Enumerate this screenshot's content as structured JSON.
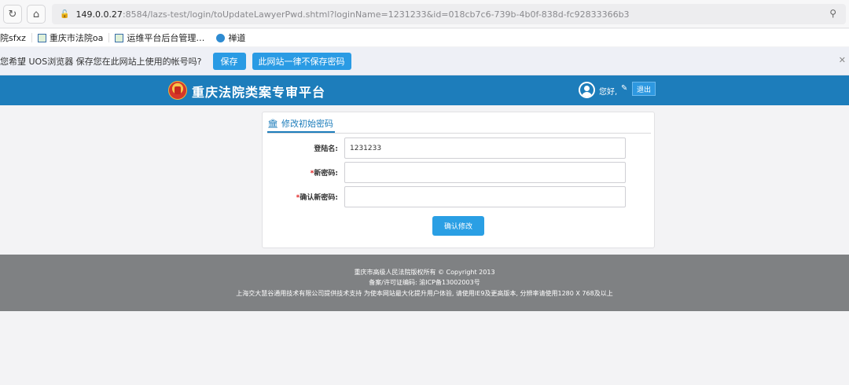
{
  "browser": {
    "url_host": "149.0.0.27",
    "url_rest": ":8584/lazs-test/login/toUpdateLawyerPwd.shtml?loginName=1231233&id=018cb7c6-739b-4b0f-838d-fc92833366b3",
    "bookmarks": [
      "院sfxz",
      "重庆市法院oa",
      "运维平台后台管理…",
      "禅道"
    ],
    "password_prompt": "您希望 UOS浏览器 保存您在此网站上使用的帐号吗?",
    "save_label": "保存",
    "never_save_label": "此网站一律不保存密码"
  },
  "header": {
    "title": "重庆法院类案专审平台",
    "greeting": "您好,",
    "logout_label": "退出"
  },
  "form": {
    "tab_title": "修改初始密码",
    "login_name_label": "登陆名:",
    "login_name_value": "1231233",
    "new_pwd_label": "新密码:",
    "confirm_pwd_label": "确认新密码:",
    "required_mark": "*",
    "submit_label": "确认修改"
  },
  "footer": {
    "line1": "重庆市高级人民法院版权所有 © Copyright 2013",
    "line2": "备案/许可证编码: 渝ICP备13002003号",
    "line3": "上海交大慧谷通用技术有限公司提供技术支持 为使本网站最大化提升用户体验, 请使用IE9及更高版本, 分辨率请使用1280 X 768及以上"
  },
  "icons": {
    "reload": "reload-icon",
    "home": "home-icon",
    "lock": "insecure-lock-icon",
    "zoom": "zoom-icon",
    "bank": "institution-icon",
    "edit": "edit-icon",
    "avatar": "user-avatar-icon"
  },
  "colors": {
    "header": "#1d7dbb",
    "button": "#2a9fe4",
    "footer": "#7f8183"
  }
}
